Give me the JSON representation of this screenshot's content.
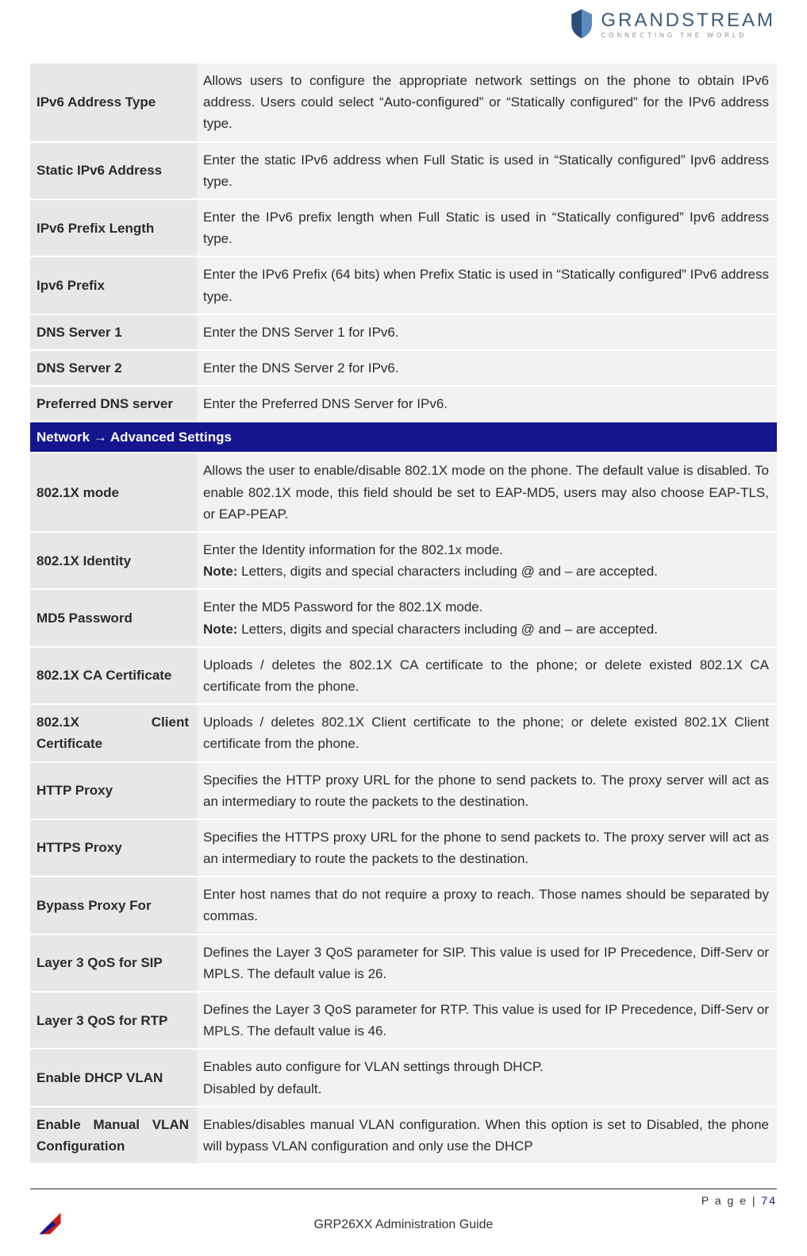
{
  "logo": {
    "main": "GRANDSTREAM",
    "sub": "CONNECTING THE WORLD"
  },
  "sections": [
    {
      "rows": [
        {
          "label": "IPv6 Address Type",
          "desc": "Allows users to configure the appropriate network settings on the phone to obtain IPv6 address. Users could select “Auto-configured” or “Statically configured” for the IPv6 address type."
        },
        {
          "label": "Static IPv6 Address",
          "desc": "Enter the static IPv6 address when Full Static is used in “Statically configured” Ipv6 address type."
        },
        {
          "label": "IPv6 Prefix Length",
          "desc": "Enter the IPv6 prefix length when Full Static is used in “Statically configured” Ipv6 address type."
        },
        {
          "label": "Ipv6 Prefix",
          "desc": "Enter the IPv6 Prefix (64 bits) when Prefix Static is used in “Statically configured” IPv6 address type."
        },
        {
          "label": "DNS Server 1",
          "desc": "Enter the DNS Server 1 for IPv6."
        },
        {
          "label": "DNS Server 2",
          "desc": "Enter the DNS Server 2 for IPv6."
        },
        {
          "label": "Preferred DNS server",
          "desc": "Enter the Preferred DNS Server for IPv6."
        }
      ]
    },
    {
      "header": "Network → Advanced Settings",
      "rows": [
        {
          "label": "802.1X mode",
          "desc": "Allows the user to enable/disable 802.1X mode on the phone. The default value is disabled. To enable 802.1X mode, this field should be set to EAP-MD5, users may also choose EAP-TLS, or EAP-PEAP."
        },
        {
          "label": "802.1X Identity",
          "desc": "Enter the Identity information for the 802.1x mode.",
          "note": "Letters, digits and special characters including @ and – are accepted."
        },
        {
          "label": "MD5 Password",
          "desc": "Enter the MD5 Password for the 802.1X mode.",
          "note": "Letters, digits and special characters including @ and – are accepted."
        },
        {
          "label": "802.1X CA Certificate",
          "desc": "Uploads / deletes the 802.1X CA certificate to the phone; or delete existed 802.1X CA certificate from the phone."
        },
        {
          "label": "802.1X Client Certificate",
          "desc": "Uploads / deletes 802.1X Client certificate to the phone; or delete existed 802.1X Client certificate from the phone."
        },
        {
          "label": "HTTP Proxy",
          "desc": "Specifies the HTTP proxy URL for the phone to send packets to. The proxy server will act as an intermediary to route the packets to the destination."
        },
        {
          "label": "HTTPS Proxy",
          "desc": "Specifies the HTTPS proxy URL for the phone to send packets to. The proxy server will act as an intermediary to route the packets to the destination."
        },
        {
          "label": "Bypass Proxy For",
          "desc": "Enter host names that do not require a proxy to reach. Those names should be separated by commas."
        },
        {
          "label": "Layer 3 QoS for SIP",
          "desc": "Defines the Layer 3 QoS parameter for SIP. This value is used for IP Precedence, Diff-Serv or MPLS. The default value is 26."
        },
        {
          "label": "Layer 3 QoS for RTP",
          "desc": "Defines the Layer 3 QoS parameter for RTP. This value is used for IP Precedence, Diff-Serv or MPLS. The default value is 46."
        },
        {
          "label": "Enable DHCP VLAN",
          "desc": "Enables auto configure for VLAN settings through DHCP.\nDisabled by default."
        },
        {
          "label": "Enable Manual VLAN Configuration",
          "desc": "Enables/disables manual VLAN configuration. When this option is set to Disabled, the phone will bypass VLAN configuration and only use the DHCP"
        }
      ]
    }
  ],
  "note_label": "Note:",
  "footer": {
    "page_label": "P a g e  | ",
    "page_num": "74",
    "title": "GRP26XX Administration Guide"
  }
}
